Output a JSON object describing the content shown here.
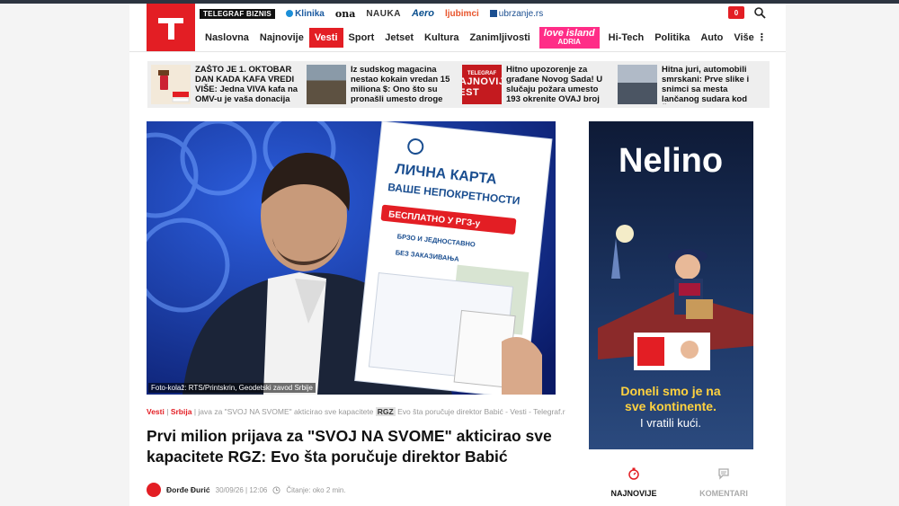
{
  "logo": {
    "letter": "T"
  },
  "subnav": {
    "biznis": "TELEGRAF BIZNIS",
    "links": [
      "Klinika",
      "ona",
      "NAUKA",
      "Aero",
      "ljubimci",
      "ubrzanje.rs"
    ]
  },
  "notifications": {
    "count": "0"
  },
  "mainnav": {
    "items": [
      "Naslovna",
      "Najnovije",
      "Vesti",
      "Sport",
      "Jetset",
      "Kultura",
      "Zanimljivosti",
      "Hi-Tech",
      "Politika",
      "Auto",
      "Više"
    ],
    "love_island": {
      "line1": "love island",
      "line2": "ADRIA"
    }
  },
  "teasers": [
    {
      "title": "ZAŠTO JE 1. OKTOBAR DAN KADA KAFA VREDI VIŠE: Jedna VIVA kafa na OMV-u je vaša donacija za"
    },
    {
      "title": "Iz sudskog magacina nestao kokain vredan 15 miliona $: Ono što su pronašli umesto droge"
    },
    {
      "title": "Hitno upozorenje za građane Novog Sada! U slučaju požara umesto 193 okrenite OVAJ broj",
      "thumb_sub": "TELEGRAF",
      "thumb_big": "NAJNOVIJA VEST"
    },
    {
      "title": "Hitna juri, automobili smrskani: Prve slike i snimci sa mesta lančanog sudara kod Šimanovaca"
    }
  ],
  "hero": {
    "caption": "Foto-kolaž: RTS/Printskrin, Geodetski zavod Srbije",
    "poster": {
      "line1": "ЛИЧНА КАРТА",
      "line2": "ВАШЕ НЕПОКРЕТНОСТИ",
      "badge": "БЕСПЛАТНО У РГЗ-у",
      "b1": "БРЗО И ЈЕДНОСТАВНО",
      "b2": "БЕЗ ЗАКАЗИВАЊА"
    }
  },
  "breadcrumbs": {
    "cat1": "Vesti",
    "cat2": "Srbija",
    "text_before": "java za \"SVOJ NA SVOME\" akticirao sve kapacitete",
    "tag": "RGZ",
    "text_after": "Evo šta poručuje direktor Babić - Vesti - Telegraf.r"
  },
  "article": {
    "title": "Prvi milion prijava za \"SVOJ NA SVOME\" akticirao sve kapacitete RGZ: Evo šta poručuje direktor Babić",
    "author": "Đorđe Đurić",
    "date": "30/09/26 | 12:06",
    "read_time": "Čitanje: oko 2 min."
  },
  "ad": {
    "brand": "Nelino",
    "line1": "Doneli smo je na",
    "line2": "sve kontinente.",
    "line3": "I vratili kući."
  },
  "tabs": {
    "latest": "NAJNOVIJE",
    "comments": "KOMENTARI"
  },
  "colors": {
    "accent": "#e31e24",
    "love_island": "#ff2d87"
  }
}
